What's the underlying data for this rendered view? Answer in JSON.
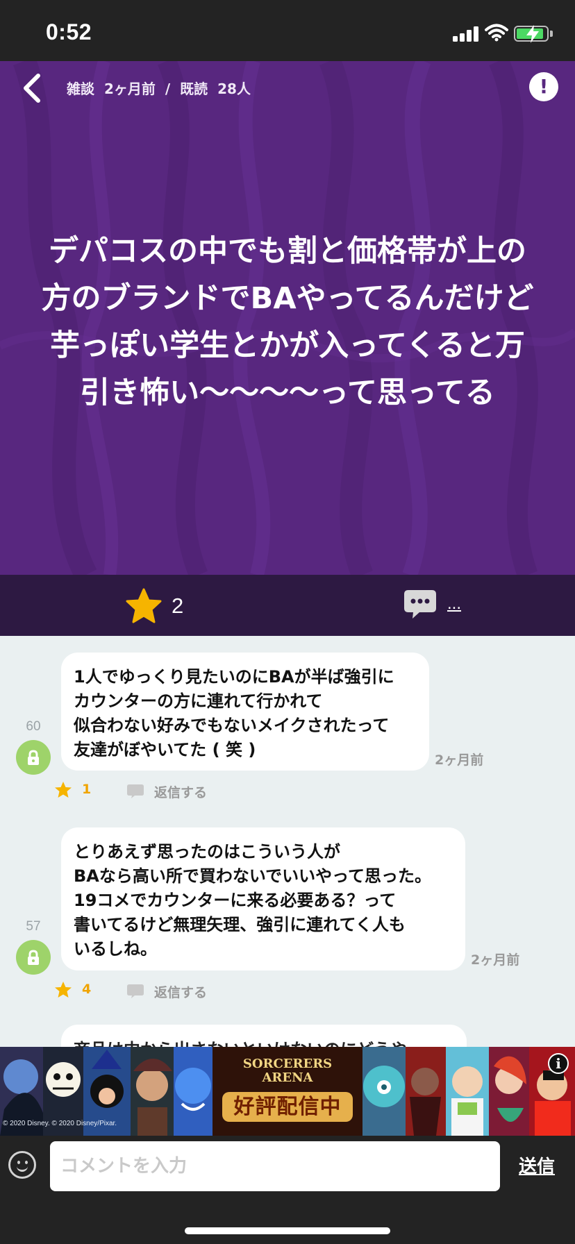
{
  "status": {
    "time": "0:52"
  },
  "post": {
    "category": "雑談",
    "age": "2ヶ月前",
    "separator": "/",
    "read_label": "既読",
    "read_count": "28人",
    "title": "デパコスの中でも割と価格帯が上の方のブランドでBAやってるんだけど芋っぽい学生とかが入ってくると万引き怖い〜〜〜〜って思ってる",
    "like_count": "2",
    "comment_count": "..."
  },
  "comments": [
    {
      "number": "60",
      "text": "1人でゆっくり見たいのにBAが半ば強引に\nカウンターの方に連れて行かれて\n似合わない好みでもないメイクされたって\n友達がぼやいてた ( 笑 )",
      "time": "2ヶ月前",
      "likes": "1",
      "reply_label": "返信する"
    },
    {
      "number": "57",
      "text": "とりあえず思ったのはこういう人が\nBAなら高い所で買わないでいいやって思った。\n19コメでカウンターに来る必要ある？って\n書いてるけど無理矢理、強引に連れてく人も\nいるしね。",
      "time": "2ヶ月前",
      "likes": "4",
      "reply_label": "返信する"
    }
  ],
  "partial_comment": "商品は中から出さないといけないのにどうや",
  "ad": {
    "logo_lines": [
      "SORCERERS",
      "ARENA"
    ],
    "status": "好評配信中",
    "copyright": "© 2020 Disney. © 2020 Disney/Pixar.",
    "info_glyph": "i"
  },
  "composer": {
    "placeholder": "コメントを入力",
    "send_label": "送信"
  },
  "colors": {
    "hero": "#58277f",
    "action_bar": "#2d1942",
    "thread_background": "#eaf0f1",
    "accent_star": "#f6b400",
    "avatar": "#9ed36a"
  },
  "icons": {
    "back": "chevron-left-icon",
    "report": "exclamation-icon",
    "like": "star-icon",
    "comment": "speech-bubble-icon",
    "avatar": "lock-icon",
    "emoji": "smiley-icon"
  }
}
